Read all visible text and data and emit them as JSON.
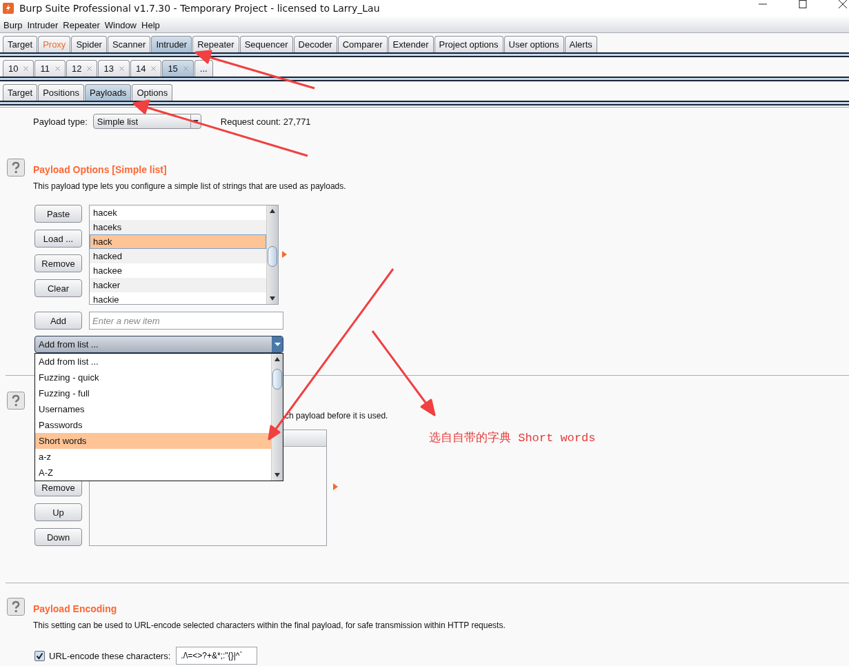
{
  "window": {
    "title": "Burp Suite Professional v1.7.30 - Temporary Project - licensed to Larry_Lau"
  },
  "menu": [
    "Burp",
    "Intruder",
    "Repeater",
    "Window",
    "Help"
  ],
  "main_tabs": [
    {
      "label": "Target",
      "selected": false,
      "highlighted": false
    },
    {
      "label": "Proxy",
      "selected": false,
      "highlighted": true
    },
    {
      "label": "Spider",
      "selected": false,
      "highlighted": false
    },
    {
      "label": "Scanner",
      "selected": false,
      "highlighted": false
    },
    {
      "label": "Intruder",
      "selected": true,
      "highlighted": false
    },
    {
      "label": "Repeater",
      "selected": false,
      "highlighted": false
    },
    {
      "label": "Sequencer",
      "selected": false,
      "highlighted": false
    },
    {
      "label": "Decoder",
      "selected": false,
      "highlighted": false
    },
    {
      "label": "Comparer",
      "selected": false,
      "highlighted": false
    },
    {
      "label": "Extender",
      "selected": false,
      "highlighted": false
    },
    {
      "label": "Project options",
      "selected": false,
      "highlighted": false
    },
    {
      "label": "User options",
      "selected": false,
      "highlighted": false
    },
    {
      "label": "Alerts",
      "selected": false,
      "highlighted": false
    }
  ],
  "attack_tabs": [
    {
      "label": "10",
      "selected": false,
      "closable": true
    },
    {
      "label": "11",
      "selected": false,
      "closable": true
    },
    {
      "label": "12",
      "selected": false,
      "closable": true
    },
    {
      "label": "13",
      "selected": false,
      "closable": true
    },
    {
      "label": "14",
      "selected": false,
      "closable": true
    },
    {
      "label": "15",
      "selected": true,
      "closable": true
    },
    {
      "label": "...",
      "selected": false,
      "closable": false
    }
  ],
  "intruder_tabs": [
    {
      "label": "Target",
      "selected": false
    },
    {
      "label": "Positions",
      "selected": false
    },
    {
      "label": "Payloads",
      "selected": true
    },
    {
      "label": "Options",
      "selected": false
    }
  ],
  "payload_type": {
    "label": "Payload type:",
    "value": "Simple list"
  },
  "request_count": "Request count: 27,771",
  "payload_options": {
    "title": "Payload Options [Simple list]",
    "description": "This payload type lets you configure a simple list of strings that are used as payloads.",
    "buttons": [
      "Paste",
      "Load ...",
      "Remove",
      "Clear"
    ],
    "items": [
      {
        "text": "hacek",
        "selected": false
      },
      {
        "text": "haceks",
        "selected": false
      },
      {
        "text": "hack",
        "selected": true
      },
      {
        "text": "hacked",
        "selected": false
      },
      {
        "text": "hackee",
        "selected": false
      },
      {
        "text": "hacker",
        "selected": false
      },
      {
        "text": "hackie",
        "selected": false
      }
    ],
    "add_button": "Add",
    "new_item": {
      "placeholder": "Enter a new item"
    },
    "add_from_list": {
      "value": "Add from list ...",
      "options": [
        {
          "text": "Add from list ...",
          "highlighted": false
        },
        {
          "text": "Fuzzing - quick",
          "highlighted": false
        },
        {
          "text": "Fuzzing - full",
          "highlighted": false
        },
        {
          "text": "Usernames",
          "highlighted": false
        },
        {
          "text": "Passwords",
          "highlighted": false
        },
        {
          "text": "Short words",
          "highlighted": true
        },
        {
          "text": "a-z",
          "highlighted": false
        },
        {
          "text": "A-Z",
          "highlighted": false
        }
      ]
    }
  },
  "payload_processing": {
    "description": "ch payload before it is used.",
    "buttons": [
      "Remove",
      "Up",
      "Down"
    ]
  },
  "payload_encoding": {
    "title": "Payload Encoding",
    "description": "This setting can be used to URL-encode selected characters within the final payload, for safe transmission within HTTP requests.",
    "url_encode": {
      "label": "URL-encode these characters:",
      "checked": true,
      "value": "./\\=<>?+&*;:\"{}|^`"
    }
  },
  "annotation": {
    "text": "选自自带的字典 Short words"
  }
}
